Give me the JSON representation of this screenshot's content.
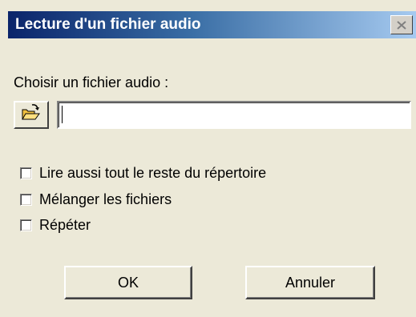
{
  "window": {
    "title": "Lecture d'un fichier audio",
    "close_glyph": "×",
    "close_icon": "close-icon"
  },
  "form": {
    "choose_label": "Choisir un fichier audio :",
    "file_value": "",
    "folder_icon": "open-folder-icon"
  },
  "options": [
    {
      "label": "Lire aussi tout le reste du répertoire",
      "checked": false
    },
    {
      "label": "Mélanger les fichiers",
      "checked": false
    },
    {
      "label": "Répéter",
      "checked": false
    }
  ],
  "buttons": {
    "ok_label": "OK",
    "cancel_label": "Annuler"
  },
  "colors": {
    "title_gradient_start": "#0a246a",
    "title_gradient_end": "#a6caf0",
    "face": "#ece9d8"
  }
}
